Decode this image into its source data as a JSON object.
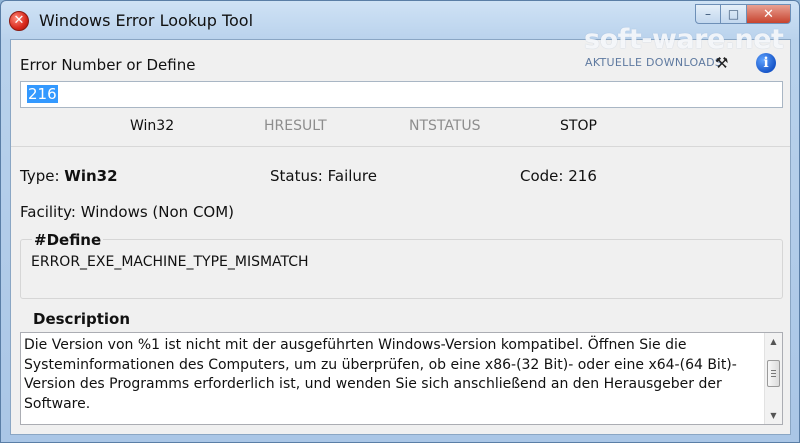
{
  "window": {
    "title": "Windows Error Lookup Tool",
    "minimize_glyph": "–",
    "maximize_glyph": "□",
    "close_glyph": "✕"
  },
  "watermark": {
    "brand": "soft-ware.net",
    "tagline": "AKTUELLE DOWNLOADS"
  },
  "input": {
    "label": "Error Number or Define",
    "value": "216"
  },
  "types": {
    "win32": "Win32",
    "hresult": "HRESULT",
    "ntstatus": "NTSTATUS",
    "stop": "STOP"
  },
  "result": {
    "type_label": "Type:",
    "type_value": "Win32",
    "status_label": "Status:",
    "status_value": "Failure",
    "code_label": "Code:",
    "code_value": "216",
    "facility_label": "Facility:",
    "facility_value": "Windows (Non COM)"
  },
  "define": {
    "title": "#Define",
    "value": "ERROR_EXE_MACHINE_TYPE_MISMATCH"
  },
  "description": {
    "title": "Description",
    "text": "Die Version von %1 ist nicht mit der ausgeführten Windows-Version kompatibel. Öffnen Sie die Systeminformationen des Computers, um zu überprüfen, ob eine x86-(32 Bit)- oder eine x64-(64 Bit)-Version des Programms erforderlich ist, und wenden Sie sich anschließend an den Herausgeber der Software."
  },
  "icons": {
    "app": "error-circle-icon",
    "tools": "tools-icon",
    "info": "info-icon"
  },
  "colors": {
    "selection": "#3399ff",
    "disabled_text": "#8d8d8d",
    "info_blue": "#1856c8",
    "error_red": "#d8281c"
  }
}
